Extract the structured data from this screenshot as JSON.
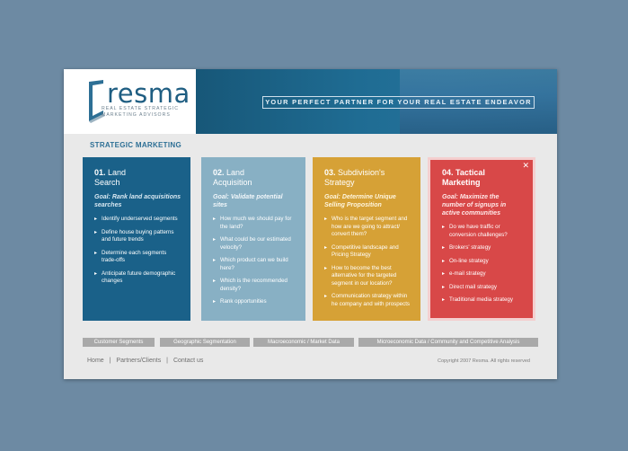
{
  "header": {
    "logo_text": "resma",
    "logo_subtitle": "REAL ESTATE STRATEGIC MARKETING ADVISORS",
    "tagline": "YOUR PERFECT PARTNER FOR YOUR REAL ESTATE ENDEAVOR"
  },
  "section_title": "STRATEGIC MARKETING",
  "cards": [
    {
      "number": "01.",
      "title_line1": "Land",
      "title_line2": "Search",
      "goal": "Goal: Rank land acquisitions searches",
      "items": [
        "Identify underserved segments",
        "Define house buying patterns and future trends",
        "Determine each segments trade-offs",
        "Anticipate future demographic changes"
      ]
    },
    {
      "number": "02.",
      "title_line1": "Land",
      "title_line2": "Acquisition",
      "goal": "Goal: Validate potential sites",
      "items": [
        "How much we should pay for the land?",
        "What could be our estimated velocity?",
        "Which product can we build here?",
        "Which is the recommended density?",
        "Rank opportunities"
      ]
    },
    {
      "number": "03.",
      "title_line1": "Subdivision's",
      "title_line2": "Strategy",
      "goal": "Goal: Determine Unique Selling Proposition",
      "items": [
        "Who is the target segment and how are we going to attract/ convert them?",
        "Competitive landscape and Pricing Strategy",
        "How to become the best alternative for the targeted segment in our location?",
        "Communication strategy within he company and with prospects"
      ]
    },
    {
      "number": "04.",
      "title_line1": "Tactical",
      "title_line2": "Marketing",
      "goal": "Goal: Maximize the number of signups in active communities",
      "close": "✕",
      "items": [
        "Do we have traffic or conversion challenges?",
        "Brokers' strategy",
        "On-line strategy",
        "e-mail strategy",
        "Direct mail strategy",
        "Traditional media strategy"
      ]
    }
  ],
  "tabs": [
    "Customer Segments",
    "Geographic Segmentation",
    "Macroeconomic / Market Data",
    "Microeconomic Data / Community and Competitive Analysis"
  ],
  "footer": {
    "links": [
      "Home",
      "Partners/Clients",
      "Contact us"
    ],
    "separator": "|",
    "copyright": "Copyright 2007 Resma.  All rights reserved"
  },
  "colors": {
    "background": "#6d8aa3",
    "card1": "#1a6189",
    "card2": "#88b0c4",
    "card3": "#d6a136",
    "card4": "#d84848"
  }
}
